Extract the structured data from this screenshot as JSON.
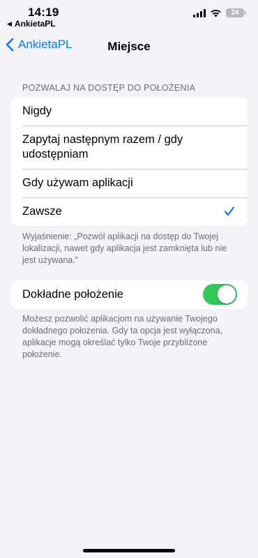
{
  "status_bar": {
    "time": "14:19",
    "back_app": "AnkietaPL",
    "battery": "24"
  },
  "nav": {
    "back_label": "AnkietaPL",
    "title": "Miejsce"
  },
  "location_access": {
    "header": "POZWALAJ NA DOSTĘP DO POŁOŻENIA",
    "options": [
      {
        "label": "Nigdy",
        "selected": false
      },
      {
        "label": "Zapytaj następnym razem / gdy udostępniam",
        "selected": false
      },
      {
        "label": "Gdy używam aplikacji",
        "selected": false
      },
      {
        "label": "Zawsze",
        "selected": true
      }
    ],
    "footer": "Wyjaśnienie: „Pozwól aplikacji na dostęp do Twojej lokalizacji, nawet gdy aplikacja jest zamknięta lub nie jest używana.”"
  },
  "precise_location": {
    "label": "Dokładne położenie",
    "enabled": true,
    "footer": "Możesz pozwolić aplikacjom na używanie Twojego dokładnego położenia. Gdy ta opcja jest wyłączona, aplikacje mogą określać tylko Twoje przybliżone położenie."
  },
  "colors": {
    "accent": "#0a7aff",
    "toggle_on": "#34c759",
    "background": "#f2f2f7"
  }
}
